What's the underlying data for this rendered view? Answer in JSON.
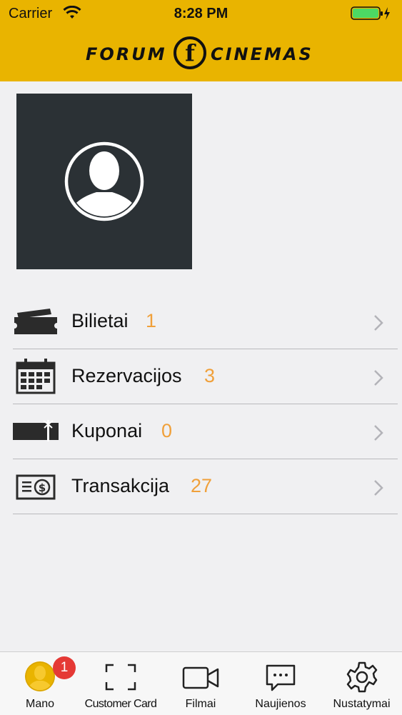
{
  "status_bar": {
    "carrier": "Carrier",
    "time": "8:28 PM"
  },
  "header": {
    "logo_left": "FORUM",
    "logo_letter": "f",
    "logo_right": "CINEMAS",
    "background": "#e9b400"
  },
  "profile": {
    "avatar_icon": "user-silhouette-icon"
  },
  "menu": {
    "items": [
      {
        "label": "Bilietai",
        "count": "1",
        "icon": "ticket-icon"
      },
      {
        "label": "Rezervacijos",
        "count": "3",
        "icon": "calendar-icon"
      },
      {
        "label": "Kuponai",
        "count": "0",
        "icon": "gift-card-icon"
      },
      {
        "label": "Transakcija",
        "count": "27",
        "icon": "money-icon"
      }
    ],
    "count_color": "#f0a03a"
  },
  "tabbar": {
    "tabs": [
      {
        "label": "Mano",
        "icon": "user-icon",
        "active": true,
        "badge": "1"
      },
      {
        "label": "Customer Card",
        "icon": "scan-frame-icon"
      },
      {
        "label": "Filmai",
        "icon": "video-camera-icon"
      },
      {
        "label": "Naujienos",
        "icon": "chat-bubble-icon"
      },
      {
        "label": "Nustatymai",
        "icon": "gear-icon"
      }
    ],
    "active_color": "#e9b400",
    "badge_color": "#e53935"
  }
}
